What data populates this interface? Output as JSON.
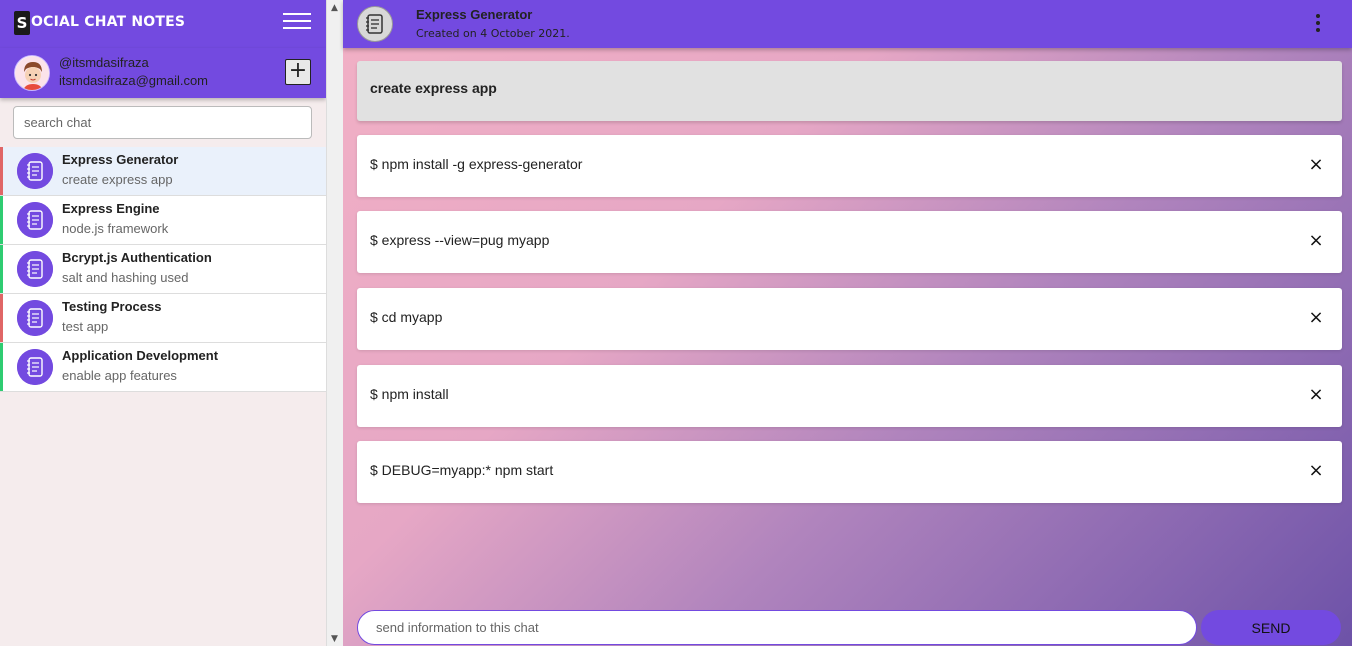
{
  "sidebar": {
    "brand_initial": "S",
    "brand_rest": "OCIAL CHAT NOTES",
    "menu_icon": "hamburger-icon",
    "profile": {
      "username": "@itsmdasifraza",
      "email": "itsmdasifraza@gmail.com",
      "add_label": "+"
    },
    "search": {
      "placeholder": "search chat"
    },
    "chats": [
      {
        "title": "Express Generator",
        "subtitle": "create express app",
        "accent": "#e06666",
        "active": true
      },
      {
        "title": "Express Engine",
        "subtitle": "node.js framework",
        "accent": "#2ecc71",
        "active": false
      },
      {
        "title": "Bcrypt.js Authentication",
        "subtitle": "salt and hashing used",
        "accent": "#2ecc71",
        "active": false
      },
      {
        "title": "Testing Process",
        "subtitle": "test app",
        "accent": "#e06666",
        "active": false
      },
      {
        "title": "Application Development",
        "subtitle": "enable app features",
        "accent": "#2ecc71",
        "active": false
      }
    ]
  },
  "main": {
    "header": {
      "title": "Express Generator",
      "subtitle": "Created on 4 October 2021."
    },
    "note_title": "create express app",
    "messages": [
      "$ npm install -g express-generator",
      "$ express --view=pug myapp",
      "$ cd myapp",
      "$ npm install",
      "$ DEBUG=myapp:* npm start"
    ],
    "close_symbol": "×",
    "composer": {
      "placeholder": "send information to this chat",
      "send_label": "SEND"
    }
  },
  "colors": {
    "accent": "#734ae0",
    "active_row": "#eaf1fb"
  }
}
